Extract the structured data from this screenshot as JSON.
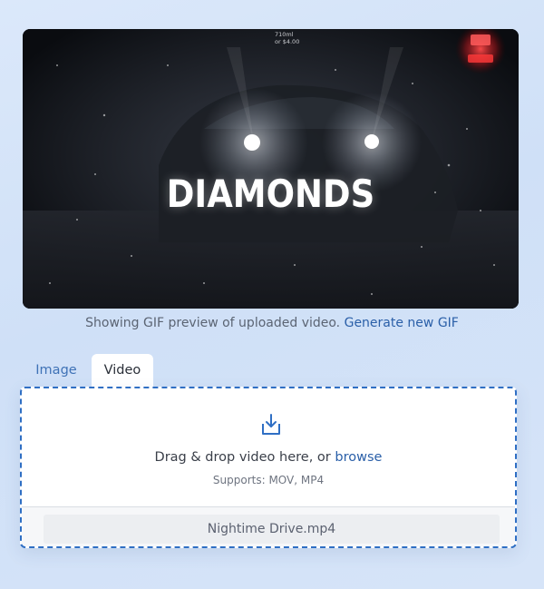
{
  "preview": {
    "title": "DIAMONDS",
    "sign_line1": "710ml",
    "sign_line2": "or $4.00"
  },
  "caption": {
    "text": "Showing GIF preview of uploaded video.",
    "link": "Generate new GIF"
  },
  "tabs": [
    {
      "label": "Image",
      "active": false
    },
    {
      "label": "Video",
      "active": true
    }
  ],
  "dropzone": {
    "prompt": "Drag & drop video here, or",
    "browse": "browse",
    "supports": "Supports: MOV, MP4",
    "file_name": "Nightime Drive.mp4",
    "icon": "download-tray-icon"
  },
  "colors": {
    "accent": "#2f6fc4",
    "link": "#2a5fa8"
  }
}
